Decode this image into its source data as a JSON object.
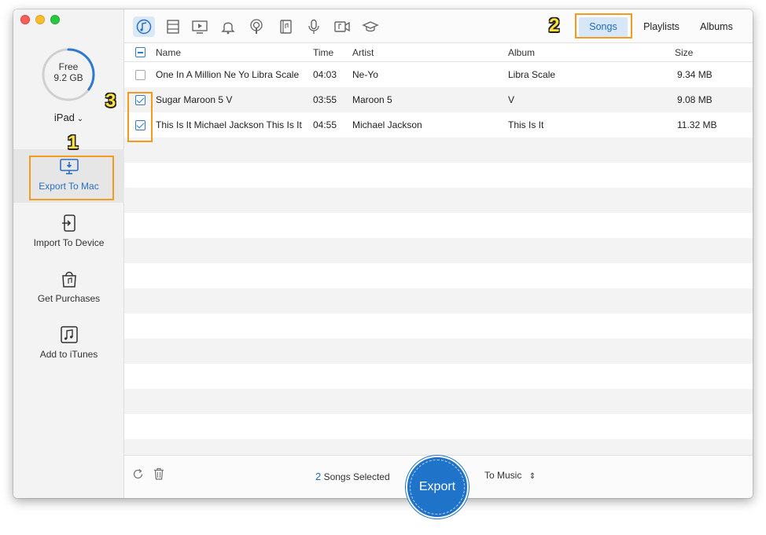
{
  "sidebar": {
    "storage_label": "Free",
    "storage_value": "9.2 GB",
    "storage_used_fraction": 0.35,
    "device_name": "iPad",
    "items": [
      {
        "label": "Export To Mac",
        "icon": "monitor-download-icon"
      },
      {
        "label": "Import To Device",
        "icon": "import-arrow-icon"
      },
      {
        "label": "Get Purchases",
        "icon": "shopping-bag-icon"
      },
      {
        "label": "Add to iTunes",
        "icon": "music-note-icon"
      }
    ]
  },
  "toolbar": {
    "categories": [
      "music-icon",
      "movies-icon",
      "tv-shows-icon",
      "ringtones-icon",
      "podcasts-icon",
      "audiobooks-icon",
      "voice-memos-icon",
      "music-videos-icon",
      "itunes-u-icon"
    ],
    "tabs": [
      "Songs",
      "Playlists",
      "Albums"
    ]
  },
  "table": {
    "headers": {
      "name": "Name",
      "time": "Time",
      "artist": "Artist",
      "album": "Album",
      "size": "Size"
    },
    "rows": [
      {
        "checked": false,
        "name": "One In A Million Ne Yo Libra Scale",
        "time": "04:03",
        "artist": "Ne-Yo",
        "album": "Libra Scale",
        "size": "9.34 MB"
      },
      {
        "checked": true,
        "name": "Sugar Maroon 5 V",
        "time": "03:55",
        "artist": "Maroon 5",
        "album": "V",
        "size": "9.08 MB"
      },
      {
        "checked": true,
        "name": "This Is It Michael Jackson This Is It",
        "time": "04:55",
        "artist": "Michael Jackson",
        "album": "This Is It",
        "size": "11.32 MB"
      }
    ]
  },
  "footer": {
    "selected_count": "2",
    "selected_text": "Songs Selected",
    "export_label": "Export",
    "destination": "To Music"
  },
  "annotations": [
    "1",
    "2",
    "3"
  ],
  "colors": {
    "accent": "#1f73c9",
    "callout": "#f39b1e",
    "number": "#ffe23a"
  }
}
